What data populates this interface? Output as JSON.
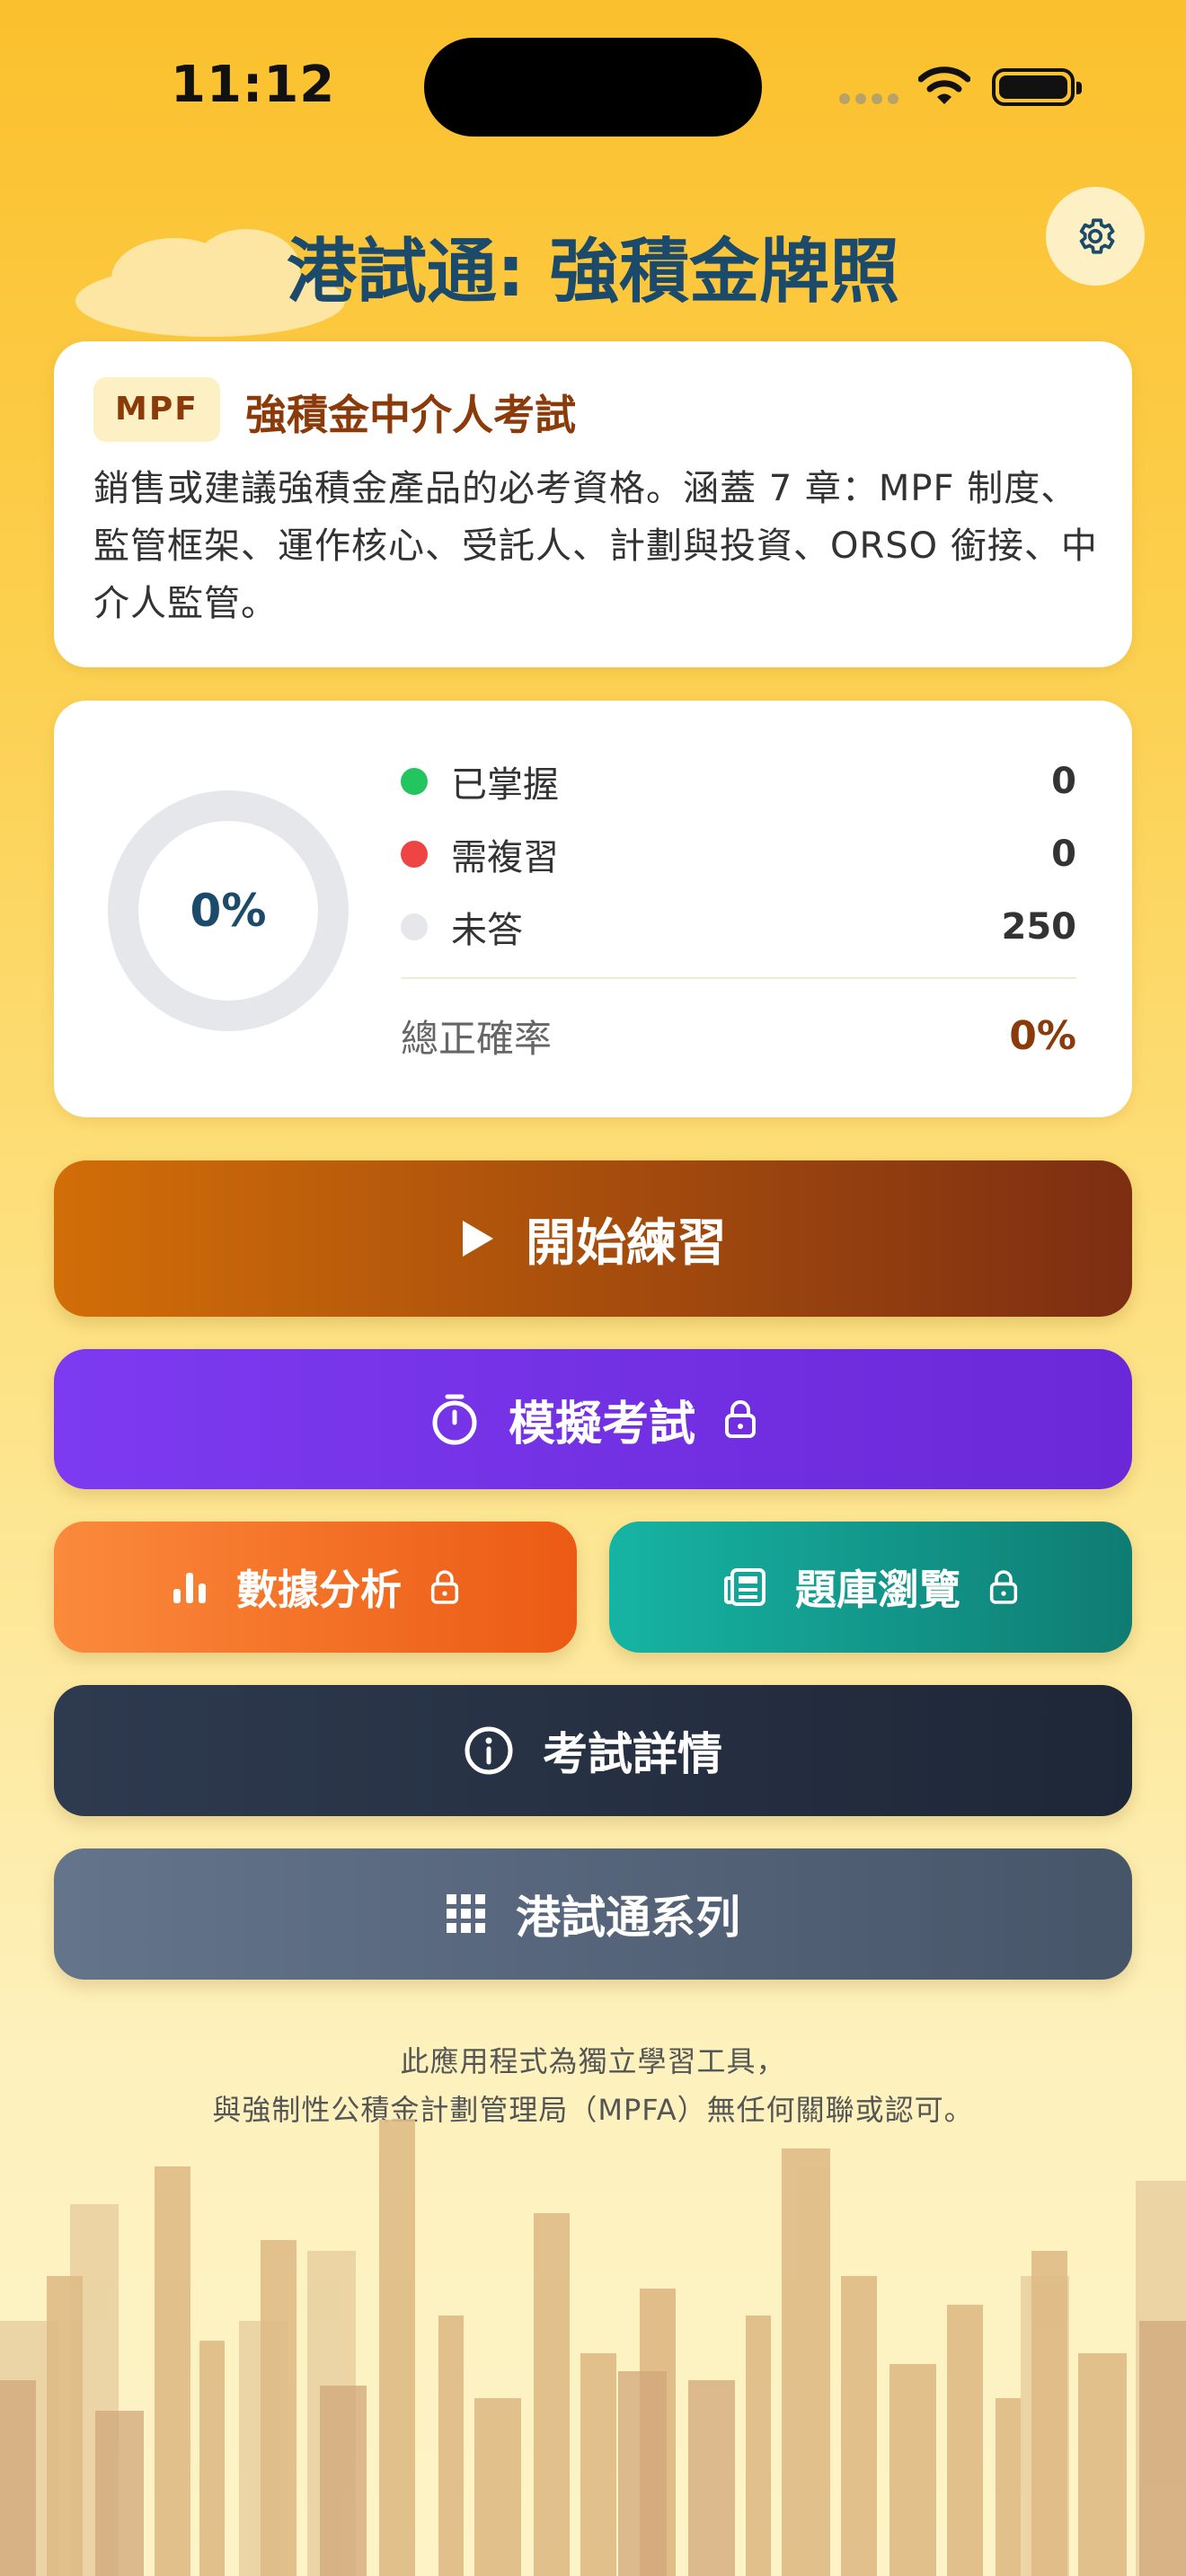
{
  "status_bar": {
    "time": "11:12"
  },
  "app_title": "港試通: 強積金牌照",
  "exam_card": {
    "badge": "MPF",
    "title": "強積金中介人考試",
    "description": "銷售或建議強積金產品的必考資格。涵蓋 7 章：MPF 制度、監管框架、運作核心、受託人、計劃與投資、ORSO 銜接、中介人監管。"
  },
  "progress": {
    "donut_percent": "0%",
    "mastered": {
      "label": "已掌握",
      "value": "0",
      "color": "#22c55e"
    },
    "review": {
      "label": "需複習",
      "value": "0",
      "color": "#ef4444"
    },
    "unanswered": {
      "label": "未答",
      "value": "250",
      "color": "#e5e7eb"
    },
    "accuracy": {
      "label": "總正確率",
      "value": "0%"
    }
  },
  "buttons": {
    "start": "開始練習",
    "mock": "模擬考試",
    "analysis": "數據分析",
    "bank": "題庫瀏覽",
    "details": "考試詳情",
    "series": "港試通系列"
  },
  "icons": {
    "settings": "gear-icon",
    "start": "play-icon",
    "mock": "stopwatch-icon",
    "lock": "lock-icon",
    "analysis": "bar-chart-icon",
    "bank": "newspaper-icon",
    "details": "info-icon",
    "series": "grid-icon"
  },
  "disclaimer": {
    "line1": "此應用程式為獨立學習工具，",
    "line2": "與強制性公積金計劃管理局（MPFA）無任何關聯或認可。"
  }
}
